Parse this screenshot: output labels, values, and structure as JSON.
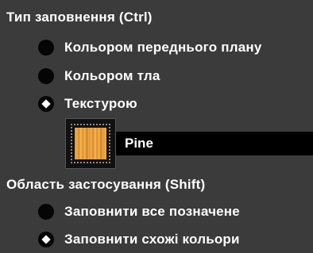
{
  "fill_type": {
    "title": "Тип заповнення  (Ctrl)",
    "options": [
      {
        "label": "Кольором переднього плану",
        "selected": false
      },
      {
        "label": "Кольором тла",
        "selected": false
      },
      {
        "label": "Текстурою",
        "selected": true
      }
    ],
    "texture": {
      "name": "Pine",
      "swatch_icon": "wood-texture-swatch"
    }
  },
  "fill_area": {
    "title": "Область застосування  (Shift)",
    "options": [
      {
        "label": "Заповнити все позначене",
        "selected": false
      },
      {
        "label": "Заповнити схожі кольори",
        "selected": true
      }
    ]
  },
  "colors": {
    "background": "#3b3b3b",
    "text": "#ffffff",
    "radio": "#050505",
    "texture_bar": "#000000"
  }
}
